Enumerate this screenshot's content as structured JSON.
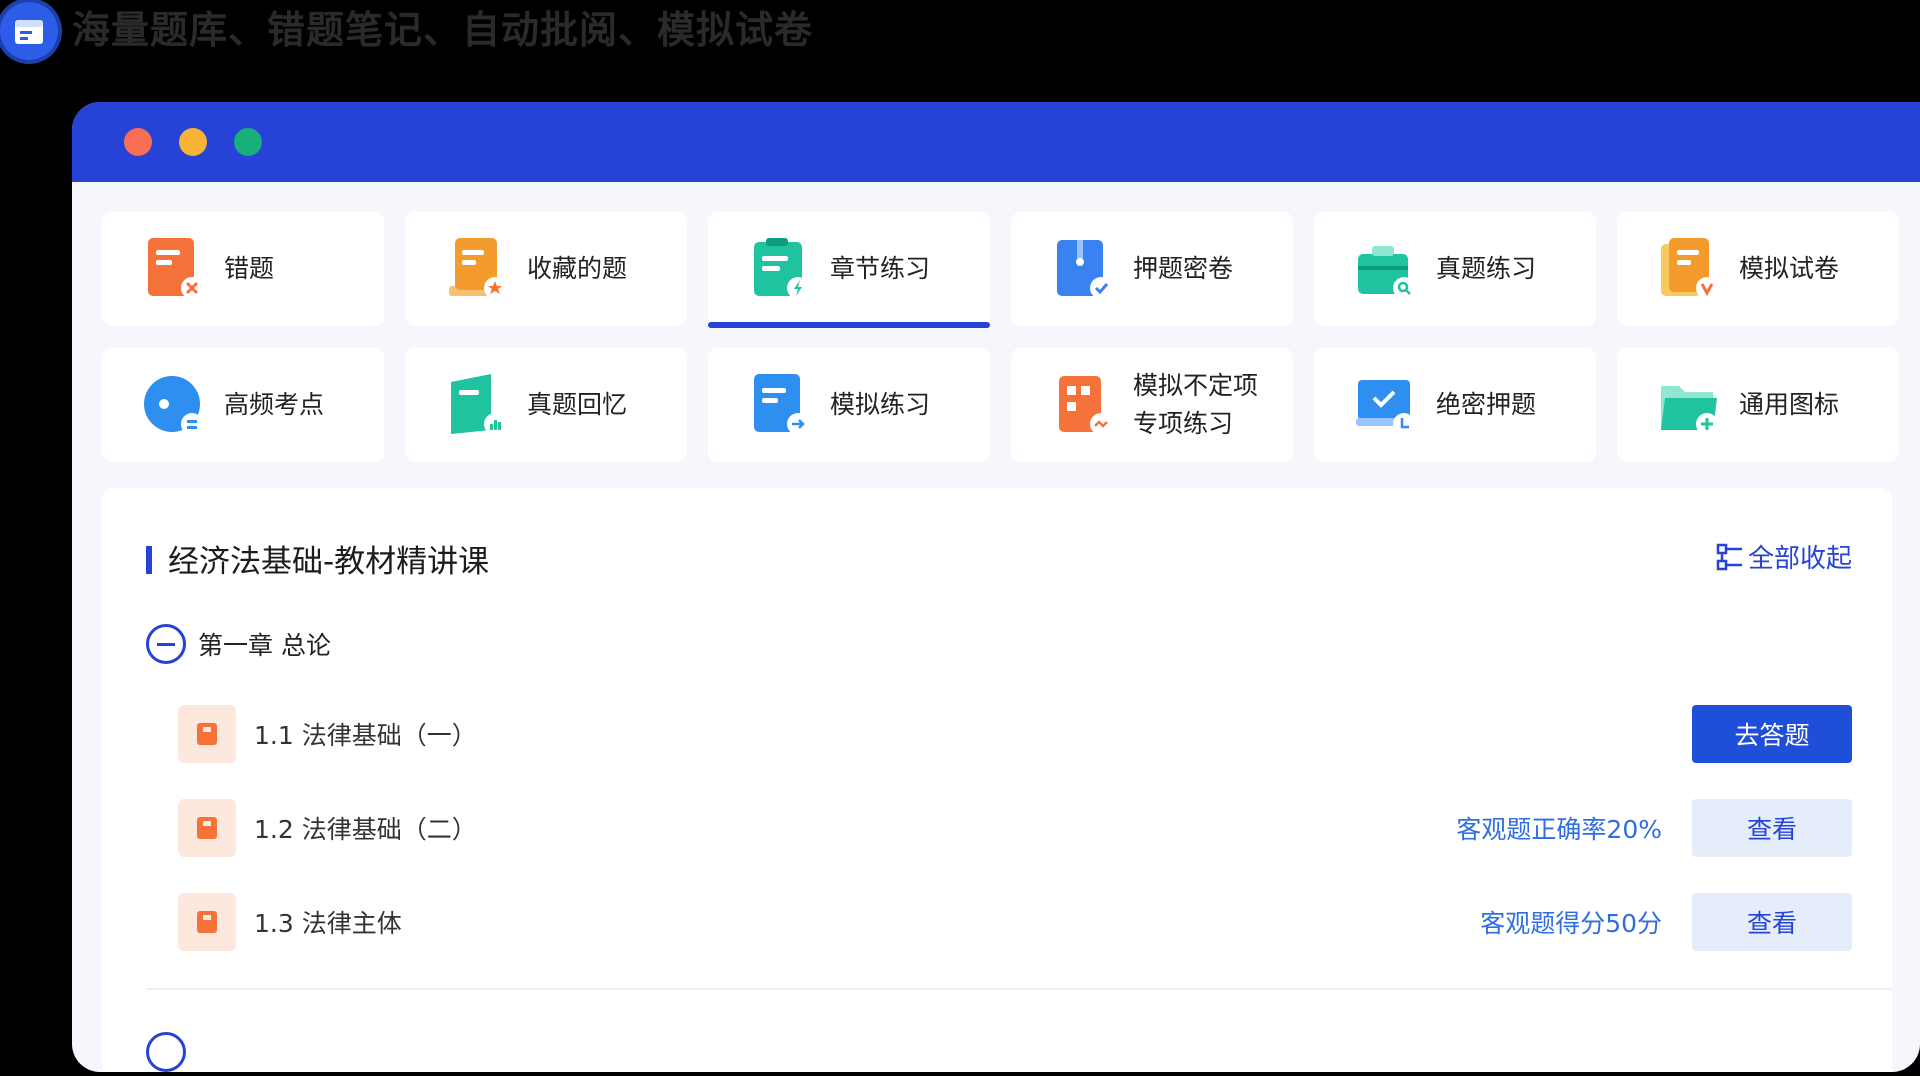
{
  "header": {
    "title": "海量题库、错题笔记、自动批阅、模拟试卷",
    "icon": "calendar-card-icon"
  },
  "window": {
    "controls": [
      "close-dot",
      "minimize-dot",
      "maximize-dot"
    ],
    "accent": "#2742d6"
  },
  "tiles": [
    {
      "label": "错题",
      "icon": "wrong-questions-icon",
      "active": false
    },
    {
      "label": "收藏的题",
      "icon": "favorites-icon",
      "active": false
    },
    {
      "label": "章节练习",
      "icon": "chapter-practice-icon",
      "active": true
    },
    {
      "label": "押题密卷",
      "icon": "secret-paper-icon",
      "active": false
    },
    {
      "label": "真题练习",
      "icon": "real-exam-practice-icon",
      "active": false
    },
    {
      "label": "模拟试卷",
      "icon": "mock-paper-icon",
      "active": false
    },
    {
      "label": "高频考点",
      "icon": "high-frequency-icon",
      "active": false
    },
    {
      "label": "真题回忆",
      "icon": "exam-recall-icon",
      "active": false
    },
    {
      "label": "模拟练习",
      "icon": "mock-practice-icon",
      "active": false
    },
    {
      "label": "模拟不定项专项练习",
      "line1": "模拟不定项",
      "line2": "专项练习",
      "icon": "indefinite-practice-icon",
      "active": false
    },
    {
      "label": "绝密押题",
      "icon": "top-secret-icon",
      "active": false
    },
    {
      "label": "通用图标",
      "icon": "common-folder-icon",
      "active": false
    }
  ],
  "course": {
    "title": "经济法基础-教材精讲课",
    "collapse_all": "全部收起",
    "chapter": "第一章 总论",
    "sections": [
      {
        "label": "1.1 法律基础（一）",
        "score": "",
        "action": "去答题",
        "action_type": "primary"
      },
      {
        "label": "1.2 法律基础（二）",
        "score": "客观题正确率20%",
        "action": "查看",
        "action_type": "secondary"
      },
      {
        "label": "1.3 法律主体",
        "score": "客观题得分50分",
        "action": "查看",
        "action_type": "secondary"
      }
    ]
  }
}
